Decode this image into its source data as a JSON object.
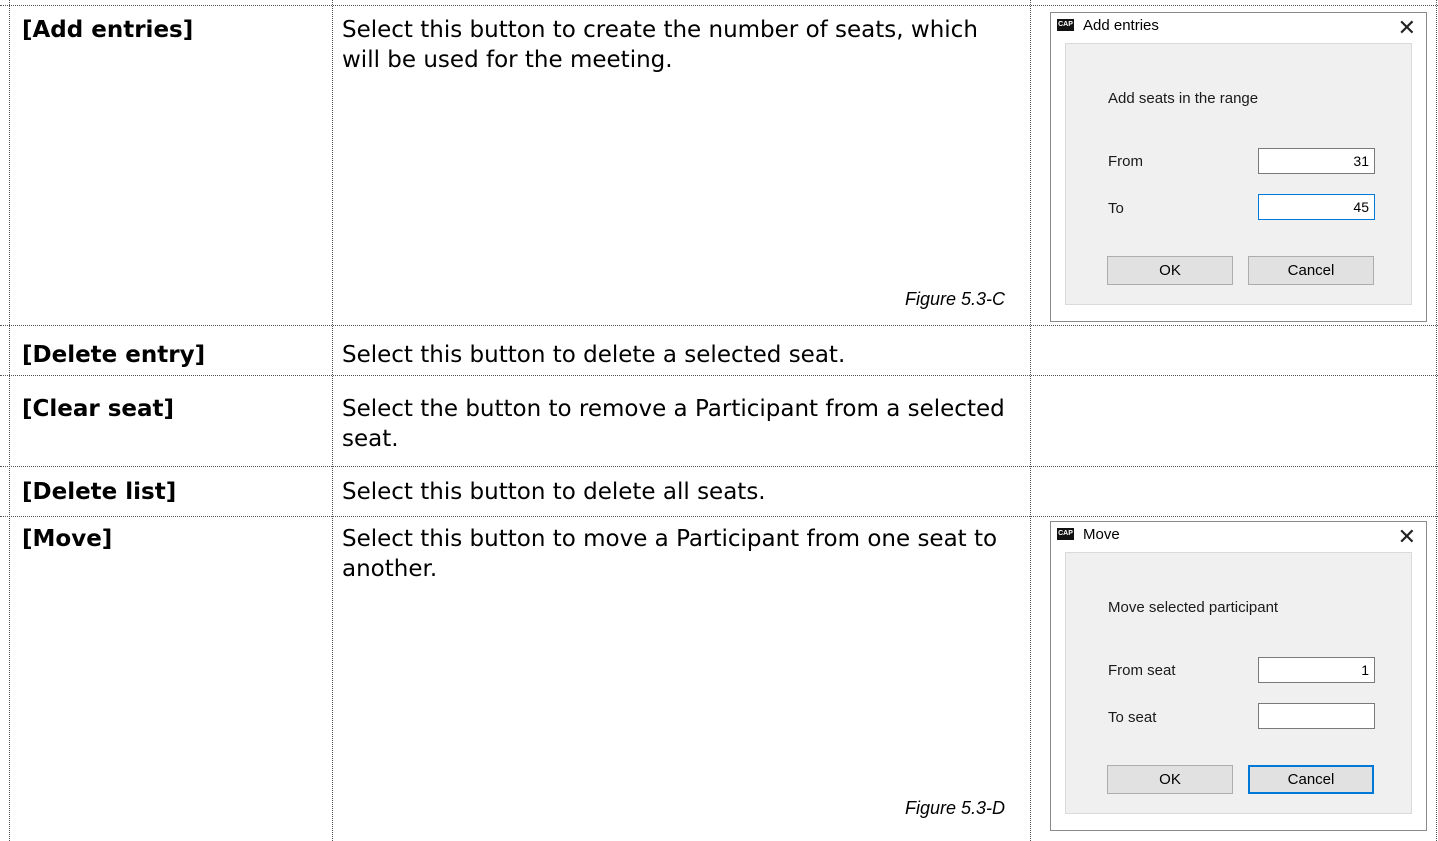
{
  "rows": [
    {
      "term": "[Add entries]",
      "description": "Select this button to create the number of seats, which will be used for the meeting.",
      "figure": "Figure 5.3-C"
    },
    {
      "term": "[Delete entry]",
      "description": "Select this button to delete a selected seat."
    },
    {
      "term": "[Clear seat]",
      "description": "Select the button to remove a Participant from a selected seat."
    },
    {
      "term": "[Delete list]",
      "description": "Select this button to delete all seats."
    },
    {
      "term": "[Move]",
      "description": "Select this button to move a Participant from one seat to another.",
      "figure": "Figure 5.3-D"
    }
  ],
  "dialog_add": {
    "app_icon": "CAP",
    "title": "Add entries",
    "close_icon": "close-icon",
    "prompt": "Add seats in the range",
    "from_label": "From",
    "from_value": "31",
    "to_label": "To",
    "to_value": "45",
    "ok_label": "OK",
    "cancel_label": "Cancel"
  },
  "dialog_move": {
    "app_icon": "CAP",
    "title": "Move",
    "close_icon": "close-icon",
    "prompt": "Move selected participant",
    "from_label": "From seat",
    "from_value": "1",
    "to_label": "To seat",
    "to_value": "",
    "ok_label": "OK",
    "cancel_label": "Cancel"
  },
  "colors": {
    "focus_border": "#0078d7",
    "panel_bg": "#f0f0f0",
    "button_bg": "#e1e1e1"
  }
}
